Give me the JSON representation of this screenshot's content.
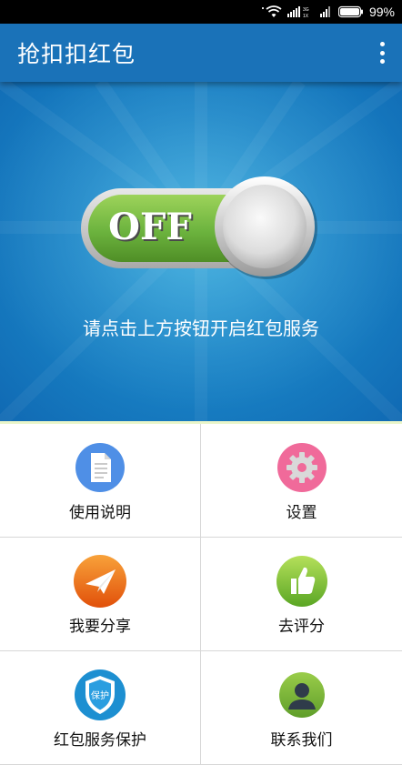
{
  "status_bar": {
    "battery_percent": "99%",
    "network_label_top": "3G",
    "network_label_bottom": "1X"
  },
  "app_bar": {
    "title": "抢扣扣红包"
  },
  "hero": {
    "toggle_state_label": "OFF",
    "caption": "请点击上方按钮开启红包服务"
  },
  "menu": {
    "items": [
      {
        "label": "使用说明",
        "icon": "document-icon",
        "color": "#4f8fe6"
      },
      {
        "label": "设置",
        "icon": "gear-icon",
        "color": "#f06a9a"
      },
      {
        "label": "我要分享",
        "icon": "paper-plane-icon",
        "color": "#f07318"
      },
      {
        "label": "去评分",
        "icon": "thumbs-up-icon",
        "color": "#8cc63f"
      },
      {
        "label": "红包服务保护",
        "icon": "shield-icon",
        "color": "#1d8fd1",
        "badge_text": "保护"
      },
      {
        "label": "联系我们",
        "icon": "user-icon",
        "color": "#7cba3e"
      }
    ]
  },
  "colors": {
    "app_bar": "#1a72b8",
    "hero_center": "#2aa6db",
    "hero_edge": "#1069b3",
    "toggle_green": "#6cb33e"
  }
}
